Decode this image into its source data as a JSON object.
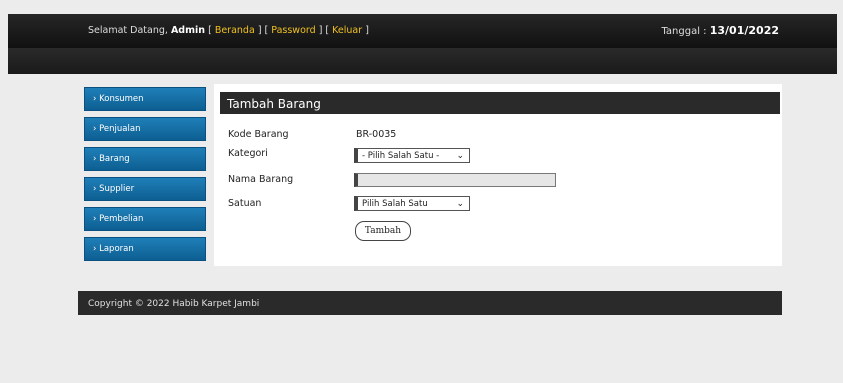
{
  "header": {
    "welcome_prefix": "Selamat Datang,",
    "user": "Admin",
    "links": [
      "Beranda",
      "Password",
      "Keluar"
    ],
    "date_label": "Tanggal :",
    "date_value": "13/01/2022"
  },
  "sidebar": {
    "items": [
      {
        "label": "› Konsumen"
      },
      {
        "label": "› Penjualan"
      },
      {
        "label": "› Barang"
      },
      {
        "label": "› Supplier"
      },
      {
        "label": "› Pembelian"
      },
      {
        "label": "› Laporan"
      }
    ]
  },
  "form": {
    "title": "Tambah Barang",
    "kode_label": "Kode Barang",
    "kode_value": "BR-0035",
    "kategori_label": "Kategori",
    "kategori_selected": "- Pilih Salah Satu -",
    "nama_label": "Nama Barang",
    "nama_value": "",
    "satuan_label": "Satuan",
    "satuan_selected": "Pilih Salah Satu",
    "submit_label": "Tambah"
  },
  "footer": {
    "text": "Copyright © 2022 Habib Karpet Jambi"
  },
  "icons": {
    "dropdown": "chevron-down-icon"
  }
}
